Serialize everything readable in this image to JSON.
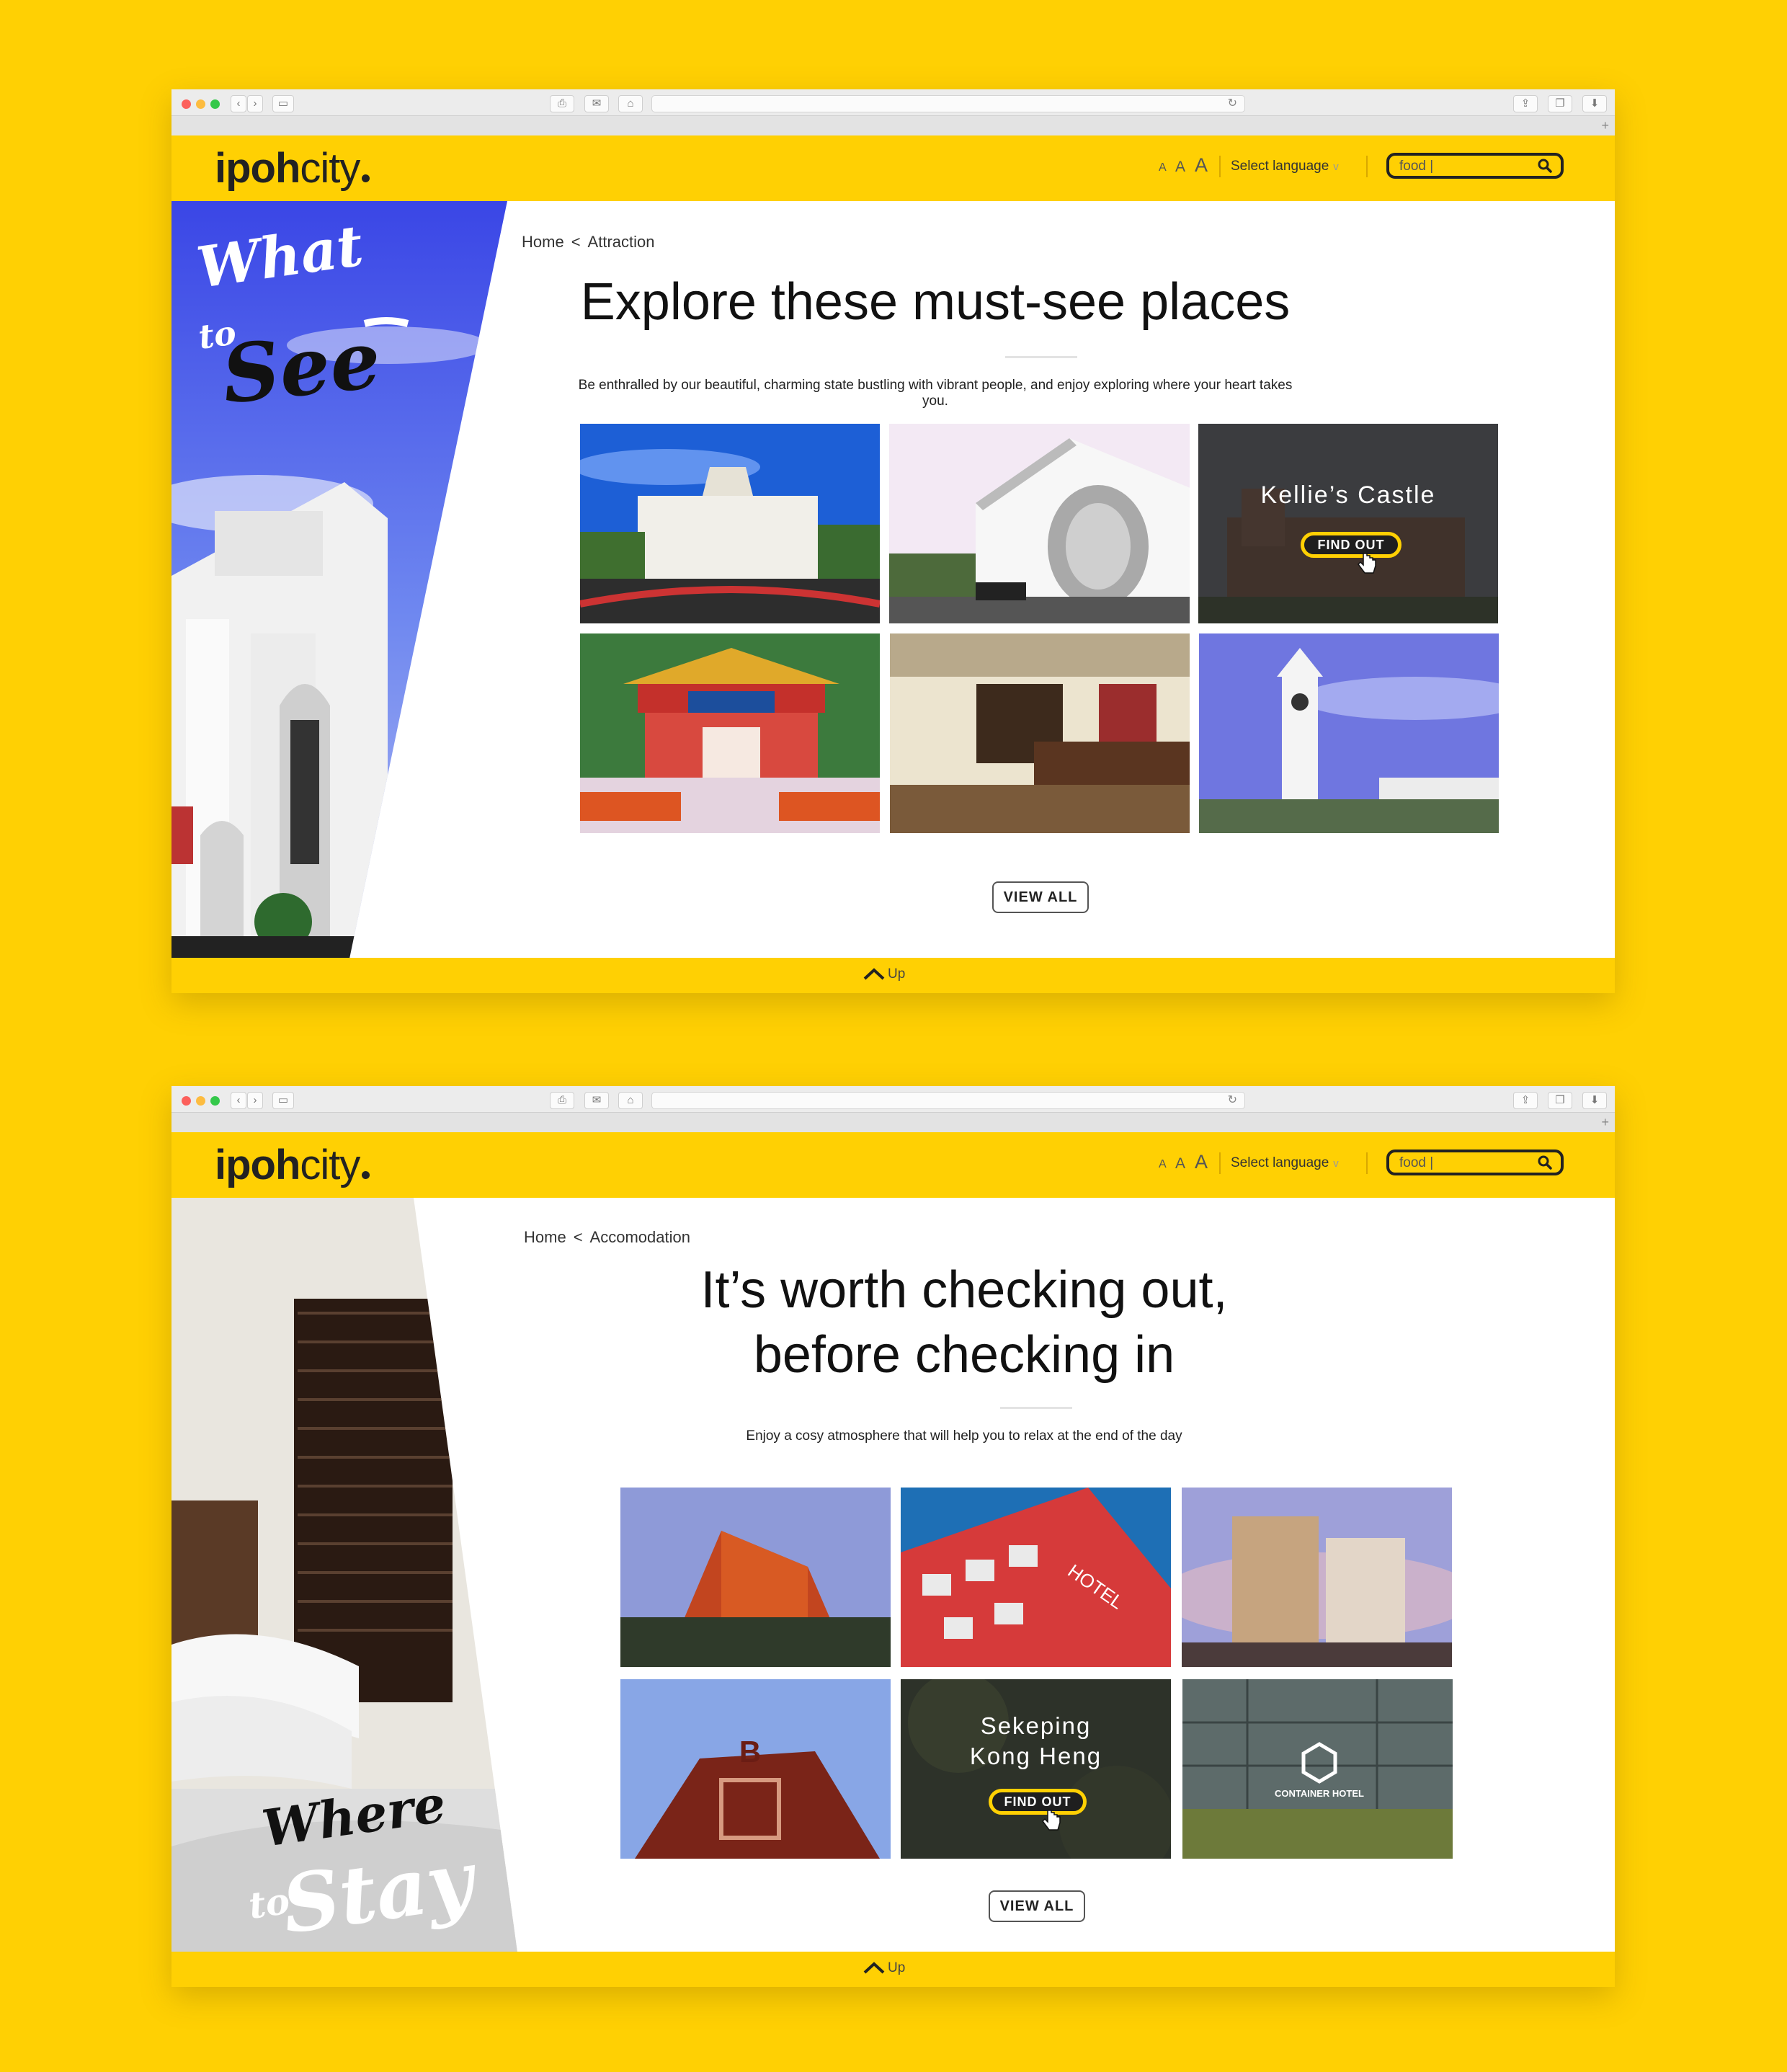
{
  "colors": {
    "brand_yellow": "#ffd003",
    "dark": "#222222"
  },
  "browser": {
    "reload_icon": "↻",
    "new_tab": "+"
  },
  "header": {
    "logo_bold": "ipoh",
    "logo_regular": "city",
    "font_small": "A",
    "font_medium": "A",
    "font_large": "A",
    "language_label": "Select language",
    "language_chevron": "v",
    "search_value": "food |",
    "search_icon": "magnifier-icon"
  },
  "attraction_page": {
    "hero_line1": "What",
    "hero_line2": "to",
    "hero_line3": "See",
    "breadcrumb_home": "Home",
    "breadcrumb_sep": "<",
    "breadcrumb_current": "Attraction",
    "title": "Explore these must-see places",
    "subtitle": "Be enthralled by our beautiful, charming state bustling with vibrant people, and enjoy exploring where your heart takes you.",
    "tiles": [
      {
        "name": ""
      },
      {
        "name": ""
      },
      {
        "name": "Kellie’s Castle",
        "button": "FIND OUT"
      },
      {
        "name": ""
      },
      {
        "name": ""
      },
      {
        "name": ""
      }
    ],
    "view_all": "VIEW ALL",
    "footer_up": "Up"
  },
  "accommodation_page": {
    "hero_line1": "Where",
    "hero_line2": "to",
    "hero_line3": "Stay",
    "breadcrumb_home": "Home",
    "breadcrumb_sep": "<",
    "breadcrumb_current": "Accomodation",
    "title_line1": "It’s worth checking out,",
    "title_line2": "before checking in",
    "subtitle": "Enjoy a cosy atmosphere that will help you to relax at the end of the day",
    "tiles": [
      {
        "name": ""
      },
      {
        "name": "",
        "sign": "HOTEL"
      },
      {
        "name": ""
      },
      {
        "name": "",
        "sign": "B"
      },
      {
        "name_line1": "Sekeping",
        "name_line2": "Kong Heng",
        "button": "FIND OUT"
      },
      {
        "name": "",
        "sign": "CONTAINER HOTEL"
      }
    ],
    "view_all": "VIEW ALL",
    "footer_up": "Up"
  }
}
